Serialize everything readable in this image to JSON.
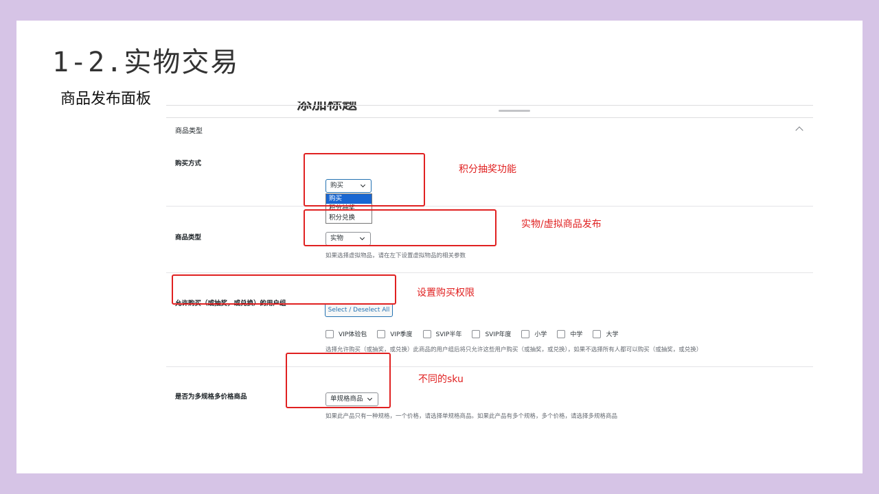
{
  "slide": {
    "title": "1-2.实物交易",
    "subtitle": "商品发布面板"
  },
  "panel": {
    "clipped_heading": "添加标题",
    "section_heading": "商品类型",
    "rows": {
      "purchase_method": {
        "label": "购买方式",
        "selected": "购买",
        "options": [
          "购买",
          "积分抽奖",
          "积分兑换"
        ]
      },
      "product_type": {
        "label": "商品类型",
        "selected": "实物",
        "help": "如果选择虚拟物品，请在左下设置虚拟物品的相关参数"
      },
      "user_groups": {
        "label": "允许购买（或抽奖，或兑换）的用户组",
        "button": "Select / Deselect All",
        "checkboxes": [
          "VIP体验包",
          "VIP季度",
          "SVIP半年",
          "SVIP年度",
          "小学",
          "中学",
          "大学"
        ],
        "help": "选择允许购买（或抽奖，或兑换）此商品的用户组后将只允许这些用户购买（或抽奖，或兑换），如果不选择所有人都可以购买（或抽奖，或兑换）"
      },
      "multi_sku": {
        "label": "是否为多规格多价格商品",
        "selected": "单规格商品",
        "help": "如果此产品只有一种规格，一个价格，请选择单规格商品。如果此产品有多个规格，多个价格，请选择多规格商品"
      }
    }
  },
  "annotations": {
    "lottery": "积分抽奖功能",
    "physical_virtual": "实物/虚拟商品发布",
    "permissions": "设置购买权限",
    "sku": "不同的sku"
  },
  "colors": {
    "background": "#d6c4e6",
    "annotation_red": "#e02020",
    "wp_blue": "#2271b1",
    "dropdown_selected": "#1967d2"
  }
}
